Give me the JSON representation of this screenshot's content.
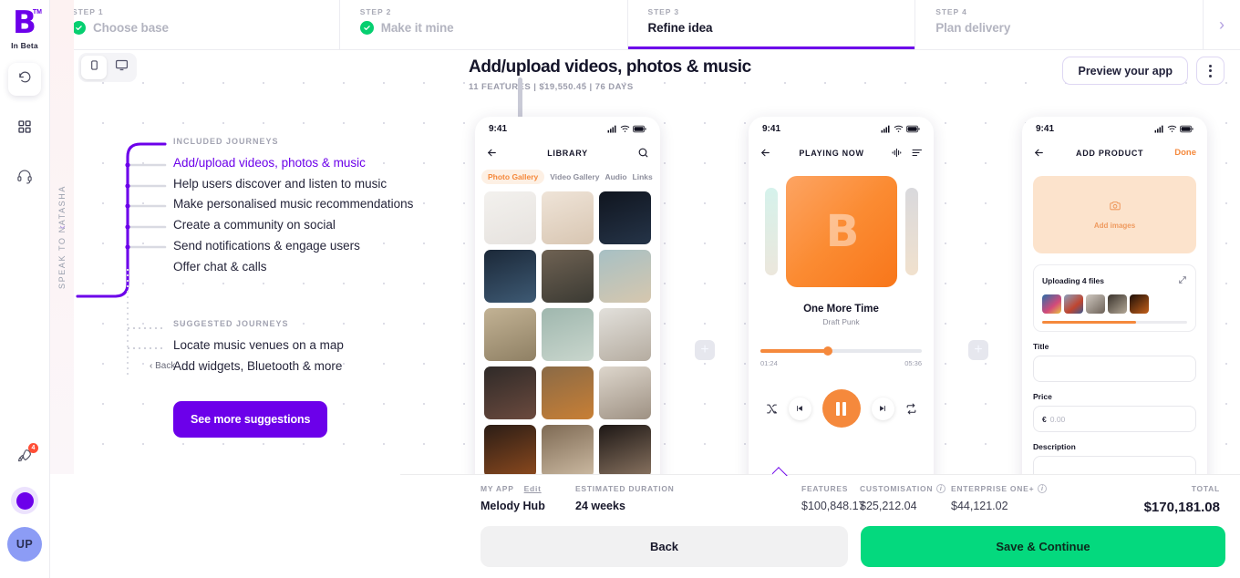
{
  "brand": {
    "logo_letter": "B",
    "trademark": "TM",
    "label": "In Beta"
  },
  "rail": {
    "undo": "undo-icon",
    "apps": "grid-icon",
    "support": "headset-icon",
    "launch": "rocket-icon",
    "launch_badge": "4",
    "status_dot": "status-dot",
    "avatar_initials": "UP"
  },
  "natasha_tab": {
    "label": "SPEAK TO NATASHA"
  },
  "stepper": {
    "steps": [
      {
        "num": "STEP 1",
        "label": "Choose base",
        "state": "complete"
      },
      {
        "num": "STEP 2",
        "label": "Make it mine",
        "state": "complete"
      },
      {
        "num": "STEP 3",
        "label": "Refine idea",
        "state": "active"
      },
      {
        "num": "STEP 4",
        "label": "Plan delivery",
        "state": "upcoming"
      }
    ],
    "next_arrow": "›"
  },
  "device_toggle": {
    "mobile": "mobile-icon",
    "desktop": "desktop-icon",
    "selected": "mobile"
  },
  "project": {
    "title": "Add/upload videos, photos & music",
    "meta": "11 FEATURES  |  $19,550.45  |  76 DAYS"
  },
  "top_actions": {
    "preview": "Preview your app",
    "more": "more-options"
  },
  "journeys": {
    "included_title": "INCLUDED JOURNEYS",
    "included": [
      "Add/upload videos, photos & music",
      "Help users discover and listen to music",
      "Make personalised music recommendations",
      "Create a community on social",
      "Send notifications & engage users",
      "Offer chat & calls"
    ],
    "selected_index": 0,
    "suggested_title": "SUGGESTED JOURNEYS",
    "suggested": [
      "Locate music venues on a map",
      "Add widgets, Bluetooth & more"
    ],
    "see_more": "See more suggestions",
    "back": "Back"
  },
  "phones": {
    "library": {
      "time": "9:41",
      "nav_title": "LIBRARY",
      "back_icon": "back-arrow-icon",
      "search_icon": "search-icon",
      "tabs": [
        "Photo Gallery",
        "Video Gallery",
        "Audio",
        "Links"
      ],
      "active_tab": "Photo Gallery"
    },
    "player": {
      "time": "9:41",
      "nav_title": "PLAYING NOW",
      "back_icon": "back-arrow-icon",
      "wave_icon": "equalizer-icon",
      "queue_icon": "queue-list-icon",
      "cover_letter": "B",
      "track_title": "One More Time",
      "artist": "Draft Punk",
      "elapsed": "01:24",
      "duration": "05:36",
      "progress_percent": 42,
      "controls": [
        "shuffle-icon",
        "previous-icon",
        "pause-icon",
        "next-icon",
        "repeat-icon"
      ]
    },
    "add_product": {
      "time": "9:41",
      "nav_title": "ADD PRODUCT",
      "back_icon": "back-arrow-icon",
      "done": "Done",
      "add_images_label": "Add images",
      "camera_icon": "camera-icon",
      "upload_title": "Uploading 4 files",
      "expand_icon": "expand-icon",
      "upload_progress_percent": 65,
      "fields": [
        {
          "label": "Title",
          "value": "",
          "placeholder": ""
        },
        {
          "label": "Price",
          "currency": "€",
          "placeholder": "0.00"
        },
        {
          "label": "Description",
          "value": "",
          "placeholder": ""
        }
      ]
    }
  },
  "canvas": {
    "add_screen": "+"
  },
  "bottom": {
    "my_app_label": "MY APP",
    "edit_link": "Edit",
    "my_app_value": "Melody Hub",
    "duration_label": "ESTIMATED DURATION",
    "duration_value": "24 weeks",
    "features_label": "FEATURES",
    "features_value": "$100,848.17",
    "customisation_label": "CUSTOMISATION",
    "customisation_value": "$25,212.04",
    "enterprise_label": "ENTERPRISE ONE+",
    "enterprise_value": "$44,121.02",
    "total_label": "TOTAL",
    "total_value": "$170,181.08",
    "info_icon": "i",
    "back_button": "Back",
    "save_button": "Save & Continue"
  },
  "colors": {
    "brand_purple": "#6c00ea",
    "accent_orange": "#f5893c",
    "success_green": "#06cf70",
    "save_green": "#04d97e",
    "badge_red": "#ff4e36"
  }
}
